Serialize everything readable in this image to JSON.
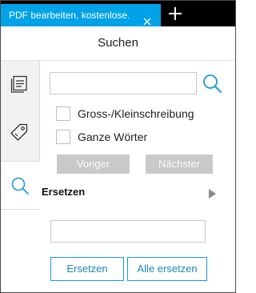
{
  "tab": {
    "title": "PDF bearbeiten, kostenlose...",
    "close_icon": "close-icon",
    "new_tab_icon": "plus-icon"
  },
  "header": {
    "title": "Suchen"
  },
  "sidebar": {
    "items": [
      {
        "name": "pages",
        "icon": "pages-icon",
        "active": false
      },
      {
        "name": "tags",
        "icon": "tag-icon",
        "active": false
      },
      {
        "name": "search",
        "icon": "search-icon",
        "active": true
      }
    ]
  },
  "search": {
    "value": "",
    "placeholder": "",
    "button_icon": "search-icon",
    "options": [
      {
        "label": "Gross-/Kleinschreibung",
        "checked": false
      },
      {
        "label": "Ganze Wörter",
        "checked": false
      }
    ],
    "prev_label": "Voriger",
    "next_label": "Nächster"
  },
  "replace": {
    "title": "Ersetzen",
    "expand_icon": "triangle-right-icon",
    "value": "",
    "placeholder": "",
    "replace_label": "Ersetzen",
    "replace_all_label": "Alle ersetzen"
  },
  "colors": {
    "accent": "#1a9ad6",
    "tab_active": "#00a2e8",
    "disabled": "#c9c9c9"
  }
}
